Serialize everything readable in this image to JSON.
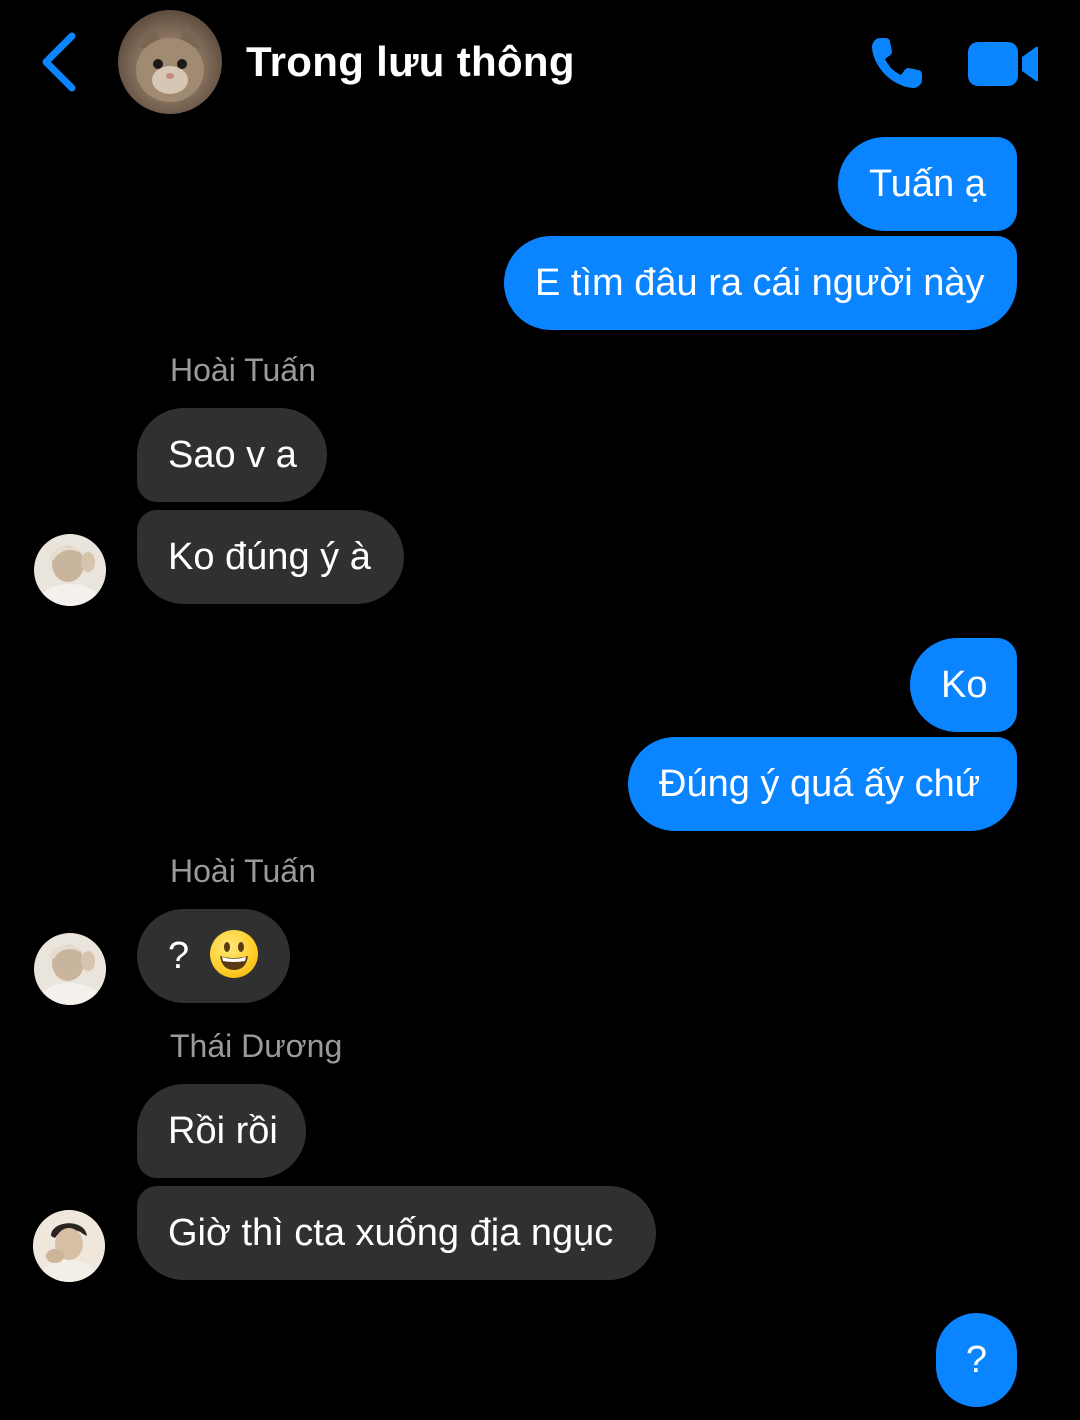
{
  "header": {
    "title": "Trong lưu thông",
    "back_icon": "chevron-left-icon",
    "call_icon": "phone-icon",
    "video_icon": "video-camera-icon",
    "accent_color": "#0a84ff"
  },
  "messages": {
    "m1": "Tuấn ạ",
    "m2": "E tìm đâu ra cái người này",
    "sender1": "Hoài Tuấn",
    "m3": "Sao v a",
    "m4": "Ko đúng ý à",
    "m5": "Ko",
    "m6": "Đúng ý quá ấy chứ",
    "sender2": "Hoài Tuấn",
    "m7": "?",
    "m7_emoji": "grinning-face-emoji",
    "sender3": "Thái Dương",
    "m8": "Rồi rồi",
    "m9": "Giờ thì cta xuống địa ngục",
    "m10": "?"
  },
  "colors": {
    "outgoing_bubble": "#0a84ff",
    "incoming_bubble": "#303030",
    "background": "#000000",
    "sender_name": "#9a9a9a"
  }
}
